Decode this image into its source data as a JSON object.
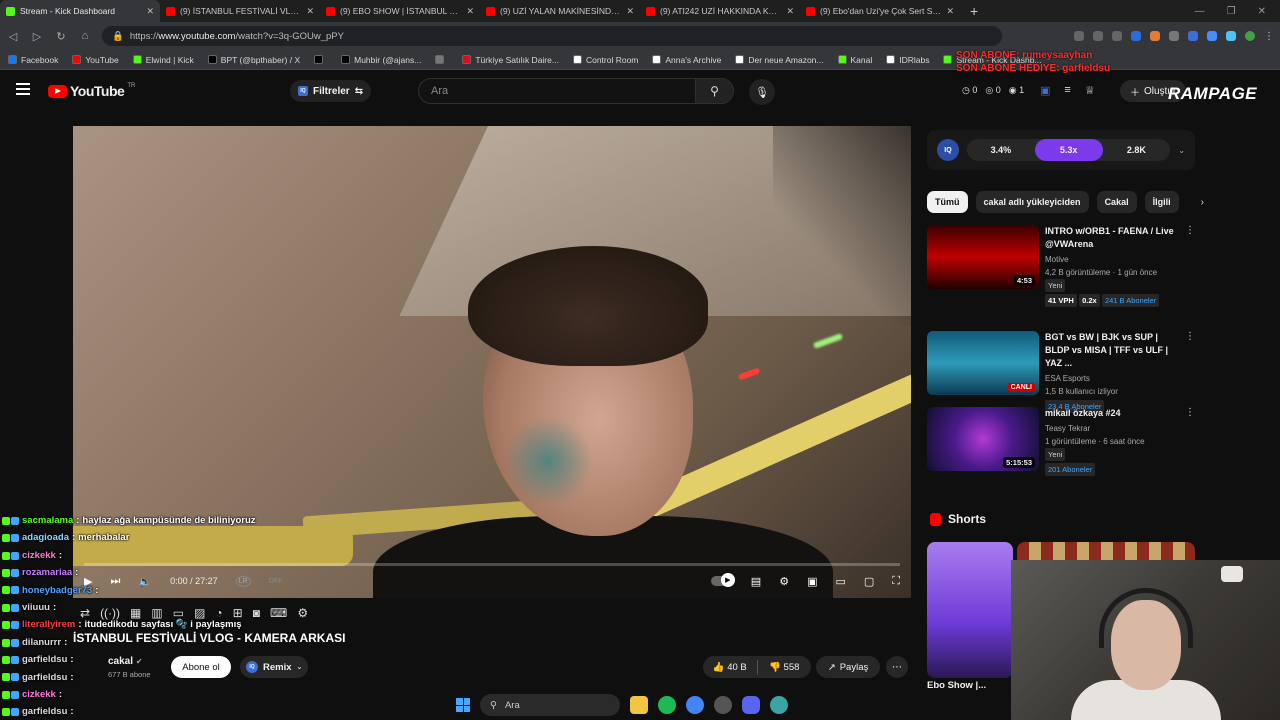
{
  "browser": {
    "tabs": [
      {
        "title": "Stream - Kick Dashboard",
        "color": "#53fc18",
        "active": true
      },
      {
        "title": "(9) İSTANBUL FESTİVALİ VLOG -",
        "color": "#ff0000"
      },
      {
        "title": "(9) EBO SHOW | İSTANBUL FESTİ",
        "color": "#ff0000"
      },
      {
        "title": "(9) UZİ YALAN MAKİNESİNDE! |",
        "color": "#ff0000"
      },
      {
        "title": "(9) ATI242 UZİ HAKKINDA KONU",
        "color": "#ff0000"
      },
      {
        "title": "(9) Ebo'dan Uzi'ye Çok Sert Sözl",
        "color": "#ff0000"
      }
    ],
    "new_tab": "+",
    "address_prefix": "https://",
    "address_domain": "www.youtube.com",
    "address_path": "/watch?v=3q-GOUw_pPY",
    "bookmarks": [
      {
        "label": "Facebook",
        "color": "#1877f2"
      },
      {
        "label": "YouTube",
        "color": "#ff0000"
      },
      {
        "label": "Elwind | Kick",
        "color": "#53fc18"
      },
      {
        "label": "BPT (@bpthaber) / X",
        "color": "#000000"
      },
      {
        "label": "",
        "color": "#000000"
      },
      {
        "label": "Muhbir (@ajans...",
        "color": "#000000"
      },
      {
        "label": "",
        "color": "#777777"
      },
      {
        "label": "Türkiye Satılık Daire...",
        "color": "#e30a17"
      },
      {
        "label": "Control Room",
        "color": "#ffffff"
      },
      {
        "label": "Anna's Archive",
        "color": "#ffffff"
      },
      {
        "label": "Der neue Amazon...",
        "color": "#ffffff"
      },
      {
        "label": "Kanal",
        "color": "#53fc18"
      },
      {
        "label": "IDRlabs",
        "color": "#ffffff"
      },
      {
        "label": "Stream - Kick Dashb...",
        "color": "#53fc18"
      }
    ]
  },
  "youtube": {
    "logo_text": "YouTube",
    "logo_region": "TR",
    "filters_label": "Filtreler",
    "search_placeholder": "Ara",
    "counters": [
      "0",
      "0",
      "1"
    ],
    "create_label": "Oluştur"
  },
  "overlay": {
    "red_line1": "SON ABONE: rumeysaayhan",
    "red_line2": "SON ABONE HEDIYE: garfieldsu",
    "rampage": "RAMPAGE"
  },
  "player": {
    "time": "0:00 / 27:27",
    "lr_label": "LR",
    "lr_state": "OFF",
    "progress": 0.0
  },
  "chat": [
    {
      "user": "sacmalama",
      "color": "#53fc18",
      "msg": "haylaz ağa kampüsünde de biliniyoruz"
    },
    {
      "user": "adagioada",
      "color": "#8ad7ff",
      "msg": "merhabalar"
    },
    {
      "user": "cizkekk",
      "color": "#ff7ad9",
      "msg": ""
    },
    {
      "user": "rozamariaa",
      "color": "#c77dff",
      "msg": ""
    },
    {
      "user": "honeybadger73",
      "color": "#4aa8ff",
      "msg": ""
    },
    {
      "user": "viiuuu",
      "color": "#d9d9d9",
      "msg": ""
    },
    {
      "user": "literallyirem",
      "color": "#ff3b3b",
      "msg": "itudedikodu sayfası 🫧 i paylaşmış"
    },
    {
      "user": "dilanurrr",
      "color": "#d9d9d9",
      "msg": ""
    },
    {
      "user": "garfieldsu",
      "color": "#d9d9d9",
      "msg": ""
    },
    {
      "user": "garfieldsu",
      "color": "#d9d9d9",
      "msg": ""
    },
    {
      "user": "cizkekk",
      "color": "#ff7ad9",
      "msg": ""
    },
    {
      "user": "garfieldsu",
      "color": "#d9d9d9",
      "msg": ""
    }
  ],
  "video": {
    "title": "İSTANBUL FESTİVALİ VLOG - KAMERA ARKASI",
    "channel": "cakal",
    "subscribers": "677 B abone",
    "subscribe_label": "Abone ol",
    "remix_label": "Remix",
    "likes": "40 B",
    "dislikes": "558",
    "share_label": "Paylaş"
  },
  "sidebar": {
    "iq_stats": [
      "3.4%",
      "5.3x",
      "2.8K"
    ],
    "chips": [
      "Tümü",
      "cakal adlı yükleyiciden",
      "Cakal",
      "İlgili"
    ],
    "recs": [
      {
        "title": "INTRO w/ORB1 - FAENA / Live @VWArena",
        "channel": "Motive",
        "meta": "4,2 B görüntüleme · 1 gün önce",
        "tag": "Yeni",
        "duration": "4:53",
        "vph": "41 VPH",
        "mult": "0.2x",
        "subs": "241 B Aboneler",
        "thumb": "linear-gradient(180deg,#3a0000 0%,#c00000 50%,#200000 100%)"
      },
      {
        "title": "BGT vs BW | BJK vs SUP | BLDP vs MISA | TFF vs ULF | YAZ ...",
        "channel": "ESA Esports",
        "meta": "1,5 B kullanıcı izliyor",
        "tag": "",
        "duration": "CANLI",
        "vph": "",
        "mult": "",
        "subs": "23,4 B Aboneler",
        "thumb": "linear-gradient(180deg,#0f5a7a 0%,#2f9bb8 50%,#0c3a52 100%)"
      },
      {
        "title": "mikail özkaya #24",
        "channel": "Teasy Tekrar",
        "meta": "1 görüntüleme · 6 saat önce",
        "tag": "Yeni",
        "duration": "5:15:53",
        "vph": "",
        "mult": "",
        "subs": "201 Aboneler",
        "thumb": "radial-gradient(circle at 50% 50%,#b13bd6 0%,#4a1a8a 45%,#101030 100%)"
      }
    ],
    "shorts_label": "Shorts",
    "short_title": "Ebo Show |..."
  },
  "taskbar": {
    "search_label": "Ara"
  }
}
